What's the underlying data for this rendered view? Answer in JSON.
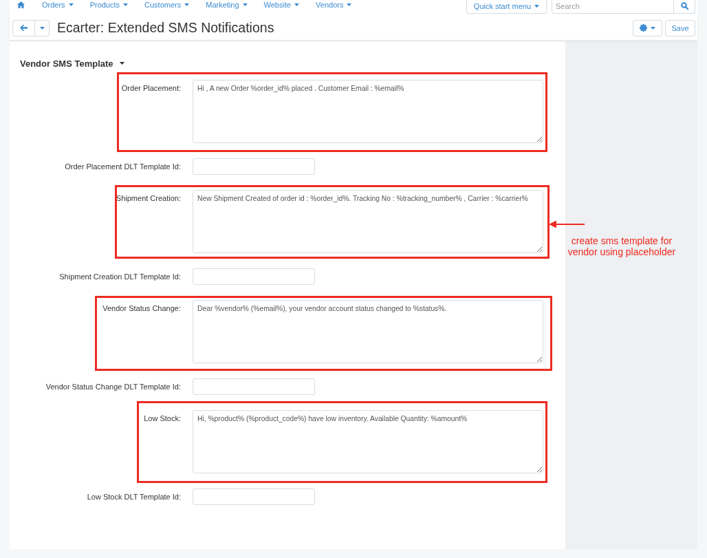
{
  "nav": {
    "items": [
      {
        "label": "Orders"
      },
      {
        "label": "Products"
      },
      {
        "label": "Customers"
      },
      {
        "label": "Marketing"
      },
      {
        "label": "Website"
      },
      {
        "label": "Vendors"
      }
    ],
    "quick_start": "Quick start menu",
    "search": {
      "placeholder": "Search"
    }
  },
  "header": {
    "title": "Ecarter: Extended SMS Notifications",
    "save": "Save"
  },
  "section": {
    "title": "Vendor SMS Template",
    "expanded": true
  },
  "fields": [
    {
      "kind": "textarea",
      "label": "Order Placement:",
      "value": "Hi , A new Order %order_id% placed . Customer Email : %email%",
      "highlighted": true
    },
    {
      "kind": "input",
      "label": "Order Placement DLT Template Id:",
      "highlighted": false
    },
    {
      "kind": "textarea",
      "label": "Shipment Creation:",
      "value": "New Shipment Created of order id : %order_id%. Tracking No : %tracking_number% , Carrier : %carrier%",
      "highlighted": true
    },
    {
      "kind": "input",
      "label": "Shipment Creation DLT Template Id:",
      "highlighted": false
    },
    {
      "kind": "textarea",
      "label": "Vendor Status Change:",
      "value": "Dear %vendor% (%email%), your vendor account status changed to %status%.",
      "highlighted": true
    },
    {
      "kind": "input",
      "label": "Vendor Status Change DLT Template Id:",
      "highlighted": false
    },
    {
      "kind": "textarea",
      "label": "Low Stock:",
      "value": "Hi, %product% (%product_code%) have low inventory. Available Quantity: %amount%",
      "highlighted": true
    },
    {
      "kind": "input",
      "label": "Low Stock DLT Template Id:",
      "highlighted": false
    }
  ],
  "annotation": {
    "text": "create sms template for vendor using placeholder"
  }
}
